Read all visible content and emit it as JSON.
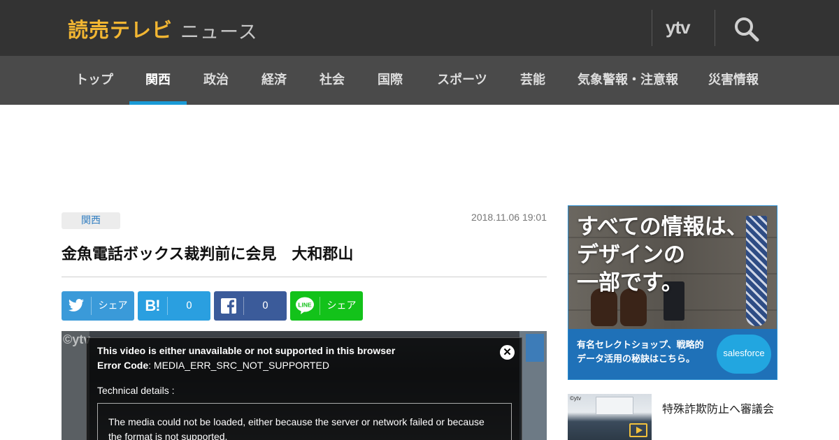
{
  "header": {
    "logo": "読売テレビ",
    "logo_sub": "ニュース",
    "channel_logo": "ytv",
    "search_icon": "search-icon",
    "bg_color": "#333333",
    "logo_color": "#f2b632"
  },
  "nav": {
    "items": [
      {
        "label": "トップ",
        "active": false
      },
      {
        "label": "関西",
        "active": true
      },
      {
        "label": "政治",
        "active": false
      },
      {
        "label": "経済",
        "active": false
      },
      {
        "label": "社会",
        "active": false
      },
      {
        "label": "国際",
        "active": false
      },
      {
        "label": "スポーツ",
        "active": false
      },
      {
        "label": "芸能",
        "active": false
      },
      {
        "label": "気象警報・注意報",
        "active": false
      },
      {
        "label": "災害情報",
        "active": false
      }
    ],
    "active_color": "#1a9ad6"
  },
  "article": {
    "category": "関西",
    "date": "2018.11.06 19:01",
    "title": "金魚電話ボックス裁判前に会見　大和郡山"
  },
  "share": {
    "twitter": {
      "icon": "twitter-bird-icon",
      "label": "シェア",
      "color": "#3a9ad9"
    },
    "hatena": {
      "icon": "hatena-bookmark-icon",
      "mark": "B!",
      "count": "0",
      "color": "#2a9fe0"
    },
    "facebook": {
      "icon": "facebook-f-icon",
      "count": "0",
      "color": "#3b5b9a"
    },
    "line": {
      "icon": "line-icon",
      "label": "シェア",
      "color": "#13c21a"
    }
  },
  "video": {
    "watermark": "©ytv",
    "error": {
      "message": "This video is either unavailable or not supported in this browser",
      "code_label": "Error Code",
      "code": ": MEDIA_ERR_SRC_NOT_SUPPORTED",
      "tech_label": "Technical details :",
      "details": "The media could not be loaded, either because the server or network failed or because the format is not supported.",
      "close": "✕"
    }
  },
  "ad": {
    "headline": [
      "すべての情報は、",
      "デザインの",
      "一部です。"
    ],
    "body": [
      "有名セレクトショップ、戦略的",
      "データ活用の秘訣はこちら。"
    ],
    "brand": "salesforce",
    "border_color": "#2a8ed0",
    "bottom_color": "#1f71b8"
  },
  "related": {
    "items": [
      {
        "title": "特殊詐欺防止へ審議会",
        "thumb_watermark": "©ytv"
      }
    ]
  }
}
